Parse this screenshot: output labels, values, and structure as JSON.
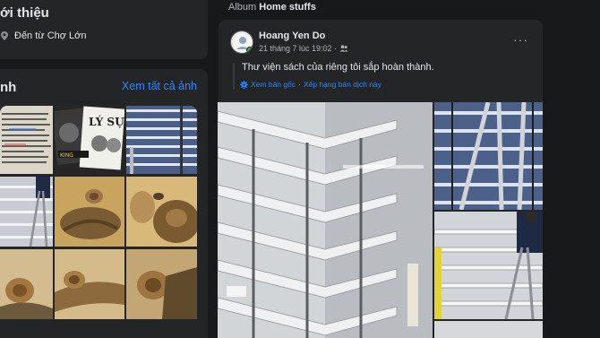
{
  "intro": {
    "title": "ới thiệu",
    "from_text": "Đến từ Chợ Lớn",
    "icon": "location-pin-icon"
  },
  "photos": {
    "title": "nh",
    "see_all": "Xem tất cả ảnh",
    "thumbnails": [
      "book-photo",
      "book-covers-photo",
      "shelves-photo",
      "ladder-photo",
      "snail-photo",
      "snail-closeup-photo",
      "snail-on-wood-photo",
      "snail-log-photo",
      "snail-bark-photo"
    ]
  },
  "album": {
    "prefix": "Album",
    "name": "Home stuffs"
  },
  "post": {
    "author": "Hoang Yen Do",
    "timestamp": "21 tháng 7 lúc 19:02 ·",
    "audience_icon": "friends-icon",
    "text": "Thư viện sách của riêng tôi sắp hoàn thành.",
    "see_original": "Xem bản gốc",
    "rate_translation": "Xếp hạng bản dịch này",
    "separator": "·",
    "more": "···"
  },
  "colors": {
    "background": "#18191a",
    "card": "#242526",
    "link": "#2d88ff",
    "secondary_text": "#b0b3b8",
    "online": "#31a24c"
  }
}
